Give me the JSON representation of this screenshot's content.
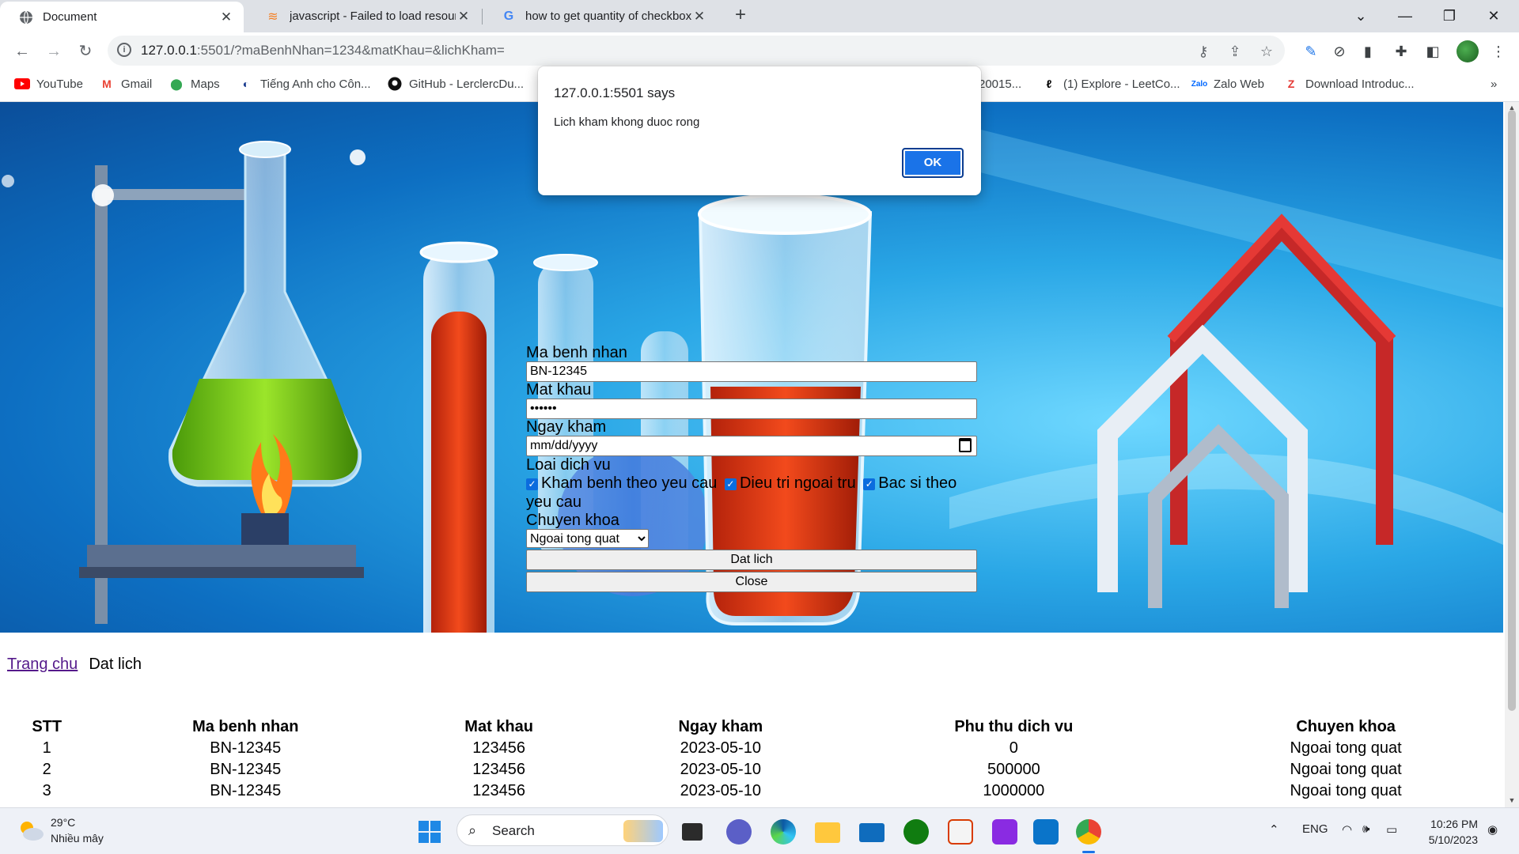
{
  "tabs": [
    {
      "title": "Document",
      "active": true
    },
    {
      "title": "javascript - Failed to load resourc",
      "active": false
    },
    {
      "title": "how to get quantity of checkbox:",
      "active": false
    }
  ],
  "address": {
    "host": "127.0.0.1",
    "rest": ":5501/?maBenhNhan=1234&matKhau=&lichKham="
  },
  "bookmarks": [
    {
      "label": "YouTube"
    },
    {
      "label": "Gmail"
    },
    {
      "label": "Maps"
    },
    {
      "label": "Tiếng Anh cho Côn..."
    },
    {
      "label": "GitHub - LerclercDu..."
    },
    {
      "label": "20015..."
    },
    {
      "label": "(1) Explore - LeetCo..."
    },
    {
      "label": "Zalo Web"
    },
    {
      "label": "Download Introduc..."
    }
  ],
  "alert": {
    "origin": "127.0.0.1:5501 says",
    "message": "Lich kham khong duoc rong",
    "ok_label": "OK"
  },
  "form": {
    "ma_label": "Ma benh nhan",
    "ma_value": "BN-12345",
    "mk_label": "Mat khau",
    "mk_value": "••••••",
    "ngay_label": "Ngay kham",
    "ngay_placeholder": "mm/dd/yyyy",
    "loai_label": "Loai dich vu",
    "services": [
      "Kham benh theo yeu cau",
      "Dieu tri ngoai tru",
      "Bac si theo yeu cau"
    ],
    "chuyen_label": "Chuyen khoa",
    "chuyen_value": "Ngoai tong quat",
    "submit_label": "Dat lich",
    "close_label": "Close"
  },
  "nav": {
    "home": "Trang chu",
    "current": "Dat lich"
  },
  "table": {
    "headers": [
      "STT",
      "Ma benh nhan",
      "Mat khau",
      "Ngay kham",
      "Phu thu dich vu",
      "Chuyen khoa"
    ],
    "rows": [
      [
        "1",
        "BN-12345",
        "123456",
        "2023-05-10",
        "0",
        "Ngoai tong quat"
      ],
      [
        "2",
        "BN-12345",
        "123456",
        "2023-05-10",
        "500000",
        "Ngoai tong quat"
      ],
      [
        "3",
        "BN-12345",
        "123456",
        "2023-05-10",
        "1000000",
        "Ngoai tong quat"
      ]
    ]
  },
  "taskbar": {
    "temp": "29°C",
    "weather": "Nhiều mây",
    "search": "Search",
    "lang": "ENG",
    "time": "10:26 PM",
    "date": "5/10/2023"
  },
  "colors": {
    "accent": "#1a73e8",
    "checkbox": "#0b6cde",
    "link_visited": "#551a8b"
  }
}
